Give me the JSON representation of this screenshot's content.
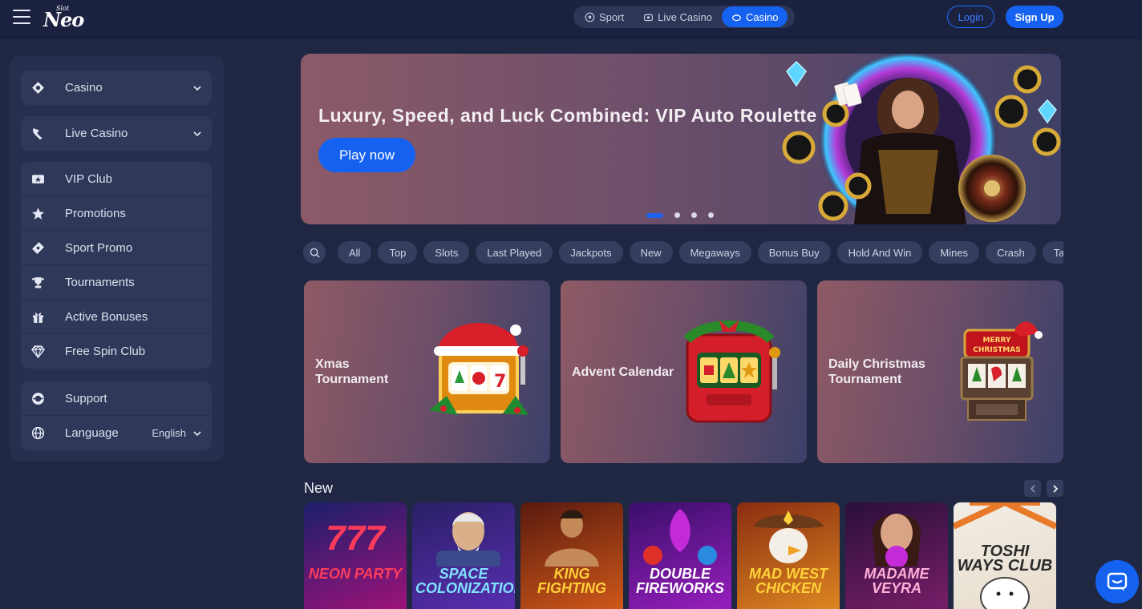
{
  "header": {
    "logo_small": "Slot",
    "logo_big": "Neo",
    "switch": [
      {
        "label": "Sport",
        "icon": "soccer-ball-icon",
        "active": false
      },
      {
        "label": "Live Casino",
        "icon": "live-casino-icon",
        "active": false
      },
      {
        "label": "Casino",
        "icon": "casino-chip-icon",
        "active": true
      }
    ],
    "login_label": "Login",
    "signup_label": "Sign Up"
  },
  "sidebar": {
    "casino": {
      "label": "Casino",
      "icon": "casino-icon"
    },
    "live_casino": {
      "label": "Live Casino",
      "icon": "live-casino-icon"
    },
    "menu": [
      {
        "label": "VIP Club",
        "icon": "vip-ticket-icon"
      },
      {
        "label": "Promotions",
        "icon": "promotions-star-icon"
      },
      {
        "label": "Sport Promo",
        "icon": "sport-promo-icon"
      },
      {
        "label": "Tournaments",
        "icon": "trophy-icon"
      },
      {
        "label": "Active Bonuses",
        "icon": "gift-icon"
      },
      {
        "label": "Free Spin Club",
        "icon": "diamond-icon"
      }
    ],
    "support": {
      "label": "Support",
      "icon": "support-headset-icon"
    },
    "language": {
      "label": "Language",
      "value": "English",
      "icon": "globe-icon"
    }
  },
  "banner": {
    "title": "Luxury, Speed, and Luck Combined: VIP Auto Roulette",
    "cta": "Play now",
    "slides": 4,
    "active_slide": 1
  },
  "categories": [
    "All",
    "Top",
    "Slots",
    "Last Played",
    "Jackpots",
    "New",
    "Megaways",
    "Bonus Buy",
    "Hold And Win",
    "Mines",
    "Crash",
    "Table"
  ],
  "tournaments": [
    {
      "line1": "Xmas",
      "line2": "Tournament"
    },
    {
      "line1": "Advent Calendar",
      "line2": ""
    },
    {
      "line1": "Daily Christmas",
      "line2": "Tournament",
      "sign": "MERRY CHRISTMAS"
    }
  ],
  "new_section": {
    "title": "New",
    "games": [
      {
        "name": "Neon Party",
        "top": "777",
        "bg1": "#1b1f6b",
        "bg2": "#a2127a",
        "color": "#ff3b5c"
      },
      {
        "name": "Space Colonization",
        "bg1": "#2a1f66",
        "bg2": "#5a2fb4",
        "color": "#7fe3ff"
      },
      {
        "name": "King Fighting",
        "bg1": "#5a1a0e",
        "bg2": "#d25a1a",
        "color": "#ffcf3a"
      },
      {
        "name": "Double Fireworks",
        "bg1": "#3a0f6a",
        "bg2": "#9b1fc0",
        "color": "#ffffff"
      },
      {
        "name": "Mad West Chicken",
        "bg1": "#8a2c10",
        "bg2": "#e08a22",
        "color": "#ffd23a"
      },
      {
        "name": "Madame Veyra",
        "bg1": "#2a0f3a",
        "bg2": "#7a1f6a",
        "color": "#ffb0d8"
      },
      {
        "name": "Toshi Ways Club",
        "bg1": "#f2ede6",
        "bg2": "#e6dccb",
        "color": "#2a2a2a"
      }
    ]
  },
  "colors": {
    "accent": "#1662f0",
    "background": "#1f2742",
    "panel": "#262f4e"
  }
}
